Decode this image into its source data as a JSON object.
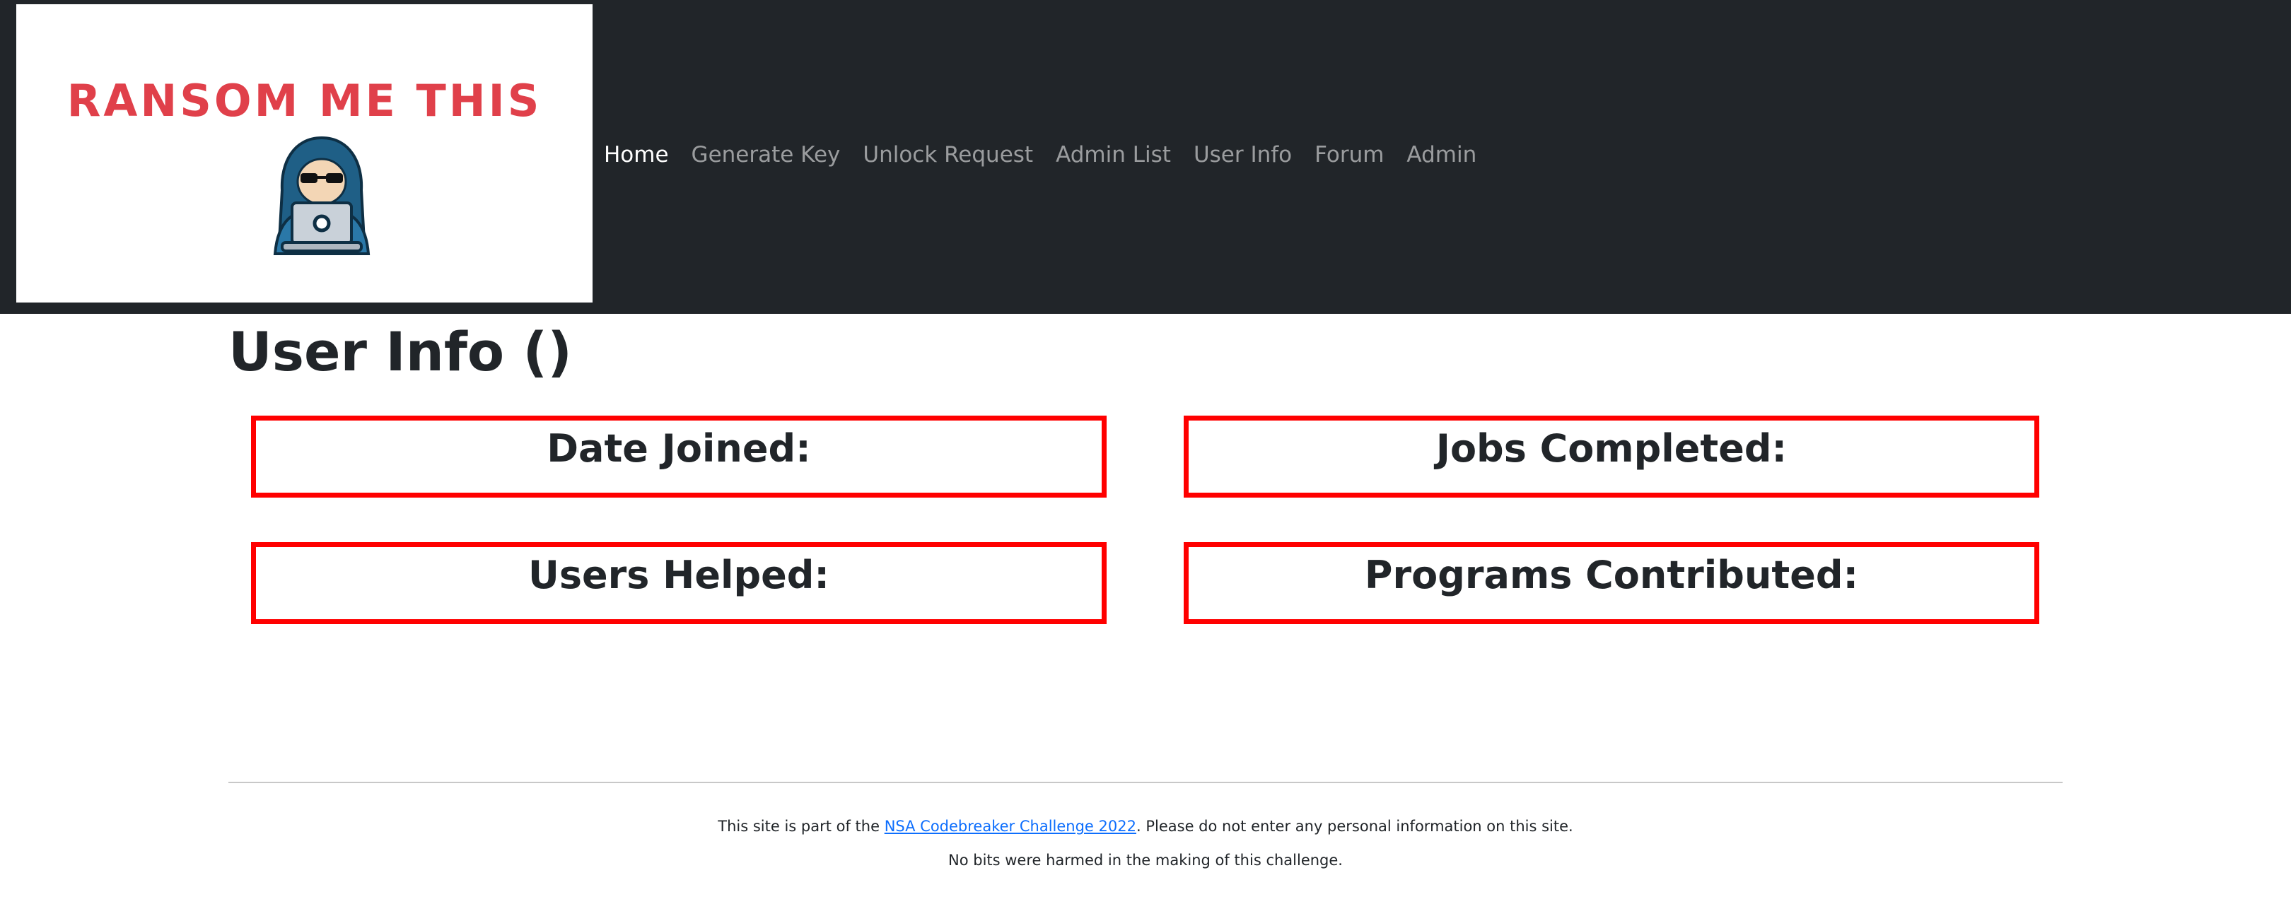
{
  "logo": {
    "text": "RANSOM ME THIS",
    "icon": "hooded-hacker-laptop-icon",
    "text_color": "#e0404a"
  },
  "nav": {
    "items": [
      {
        "label": "Home",
        "active": true
      },
      {
        "label": "Generate Key",
        "active": false
      },
      {
        "label": "Unlock Request",
        "active": false
      },
      {
        "label": "Admin List",
        "active": false
      },
      {
        "label": "User Info",
        "active": false
      },
      {
        "label": "Forum",
        "active": false
      },
      {
        "label": "Admin",
        "active": false
      }
    ]
  },
  "page": {
    "title": "User Info ()"
  },
  "stats": {
    "date_joined": "Date Joined:",
    "jobs_completed": "Jobs Completed:",
    "users_helped": "Users Helped:",
    "programs_contributed": "Programs Contributed:",
    "border_color": "#ff0000"
  },
  "footer": {
    "line1_prefix": "This site is part of the ",
    "line1_link": "NSA Codebreaker Challenge 2022",
    "line1_suffix": ". Please do not enter any personal information on this site.",
    "line2": "No bits were harmed in the making of this challenge."
  },
  "colors": {
    "navbar_bg": "#212529",
    "link": "#0d6efd"
  }
}
